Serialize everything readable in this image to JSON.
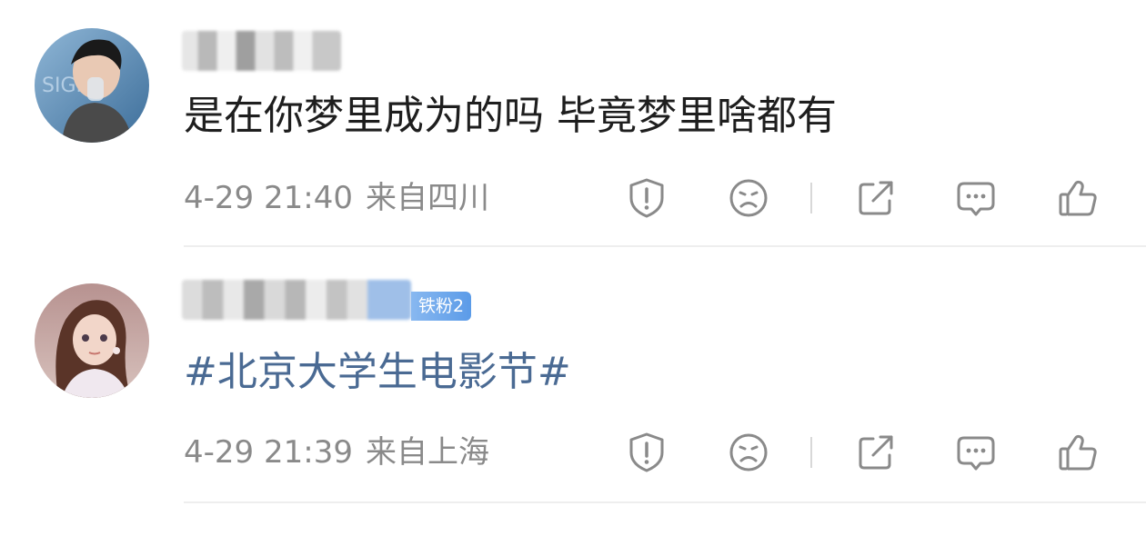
{
  "comments": [
    {
      "content": "是在你梦里成为的吗 毕竟梦里啥都有",
      "time": "4-29 21:40",
      "location": "来自四川"
    },
    {
      "badge": "铁粉2",
      "content": "#北京大学生电影节#",
      "time": "4-29 21:39",
      "location": "来自上海"
    }
  ],
  "icons": {
    "report": "shield-exclamation-icon",
    "dislike": "frown-face-icon",
    "share": "share-icon",
    "comment": "comment-bubble-icon",
    "like": "thumbs-up-icon"
  },
  "colors": {
    "topic_link": "#4a6a93",
    "meta_text": "#8a8a8a",
    "badge": "#5b9be8"
  }
}
